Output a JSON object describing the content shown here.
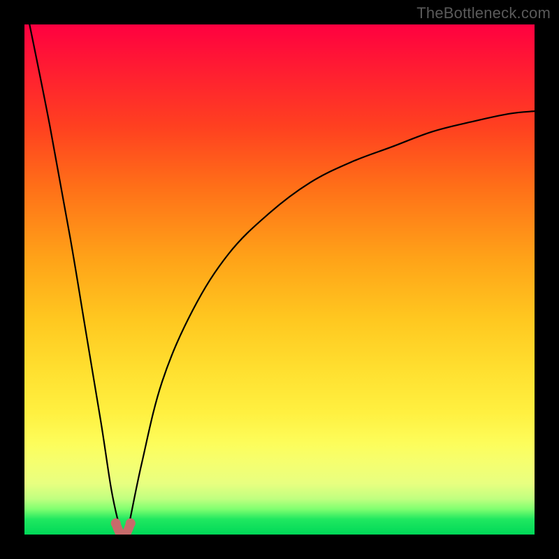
{
  "watermark": "TheBottleneck.com",
  "chart_data": {
    "type": "line",
    "title": "",
    "xlabel": "",
    "ylabel": "",
    "x_range": [
      0,
      100
    ],
    "y_range": [
      0,
      100
    ],
    "note": "Bottleneck curve: steep V near x≈19 where bottleneck ≈0%, rising toward ~100% at x=0 and ~82% at x=100. Values estimated from pixel positions (no axis ticks visible).",
    "series": [
      {
        "name": "bottleneck-percent",
        "x": [
          1,
          5,
          9,
          12,
          15,
          17,
          18.5,
          19,
          20,
          20.5,
          23,
          27,
          33,
          40,
          48,
          56,
          64,
          72,
          80,
          88,
          95,
          100
        ],
        "y": [
          100,
          80,
          58,
          40,
          22,
          9,
          2,
          0.5,
          0.5,
          2,
          14,
          30,
          44,
          55,
          63,
          69,
          73,
          76,
          79,
          81,
          82.5,
          83
        ]
      }
    ],
    "marker_points_x": [
      17.9,
      20.8
    ],
    "background_gradient": {
      "top": "#ff0040",
      "mid": "#ffd030",
      "bottom": "#00d858",
      "meaning": "red = high bottleneck, green = low bottleneck"
    }
  }
}
